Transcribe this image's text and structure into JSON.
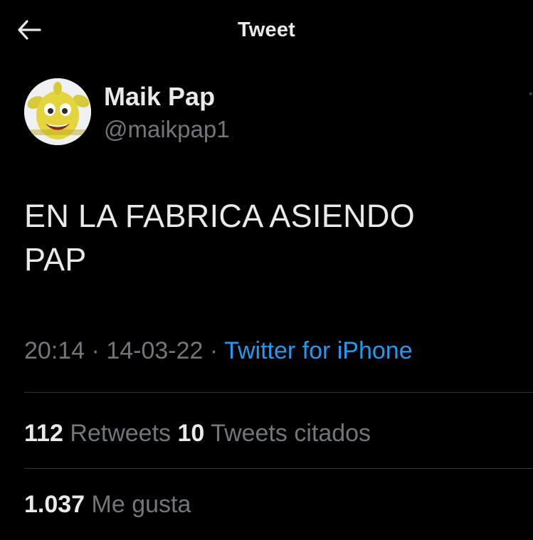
{
  "header": {
    "title": "Tweet",
    "back_icon": "arrow-left-icon"
  },
  "author": {
    "name": "Maik Pap",
    "handle": "@maikpap1",
    "avatar_icon": "avatar-image"
  },
  "tweet": {
    "text_line1": "EN LA FABRICA ASIENDO",
    "text_line2": "PAP",
    "time": "20:14",
    "date": "14-03-22",
    "separator": "·",
    "source": "Twitter for iPhone"
  },
  "stats": {
    "retweets_count": "112",
    "retweets_label": "Retweets",
    "quotes_count": "10",
    "quotes_label": "Tweets citados",
    "likes_count": "1.037",
    "likes_label": "Me gusta"
  },
  "colors": {
    "background": "#000000",
    "text": "#e7e9ea",
    "muted": "#71767b",
    "link": "#1d9bf0",
    "divider": "#2f3336"
  }
}
